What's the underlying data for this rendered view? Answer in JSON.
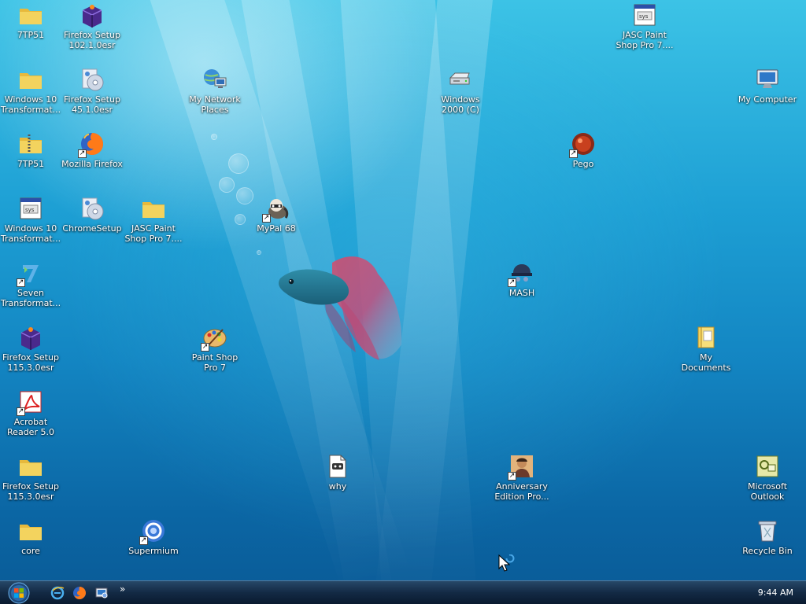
{
  "desktop": {
    "icons": [
      {
        "label": "7TP51"
      },
      {
        "label": "Firefox Setup 102.1.0esr"
      },
      {
        "label": "Windows 10 Transformat..."
      },
      {
        "label": "Firefox Setup 45.1.0esr"
      },
      {
        "label": "My Network Places"
      },
      {
        "label": "7TP51"
      },
      {
        "label": "Mozilla Firefox"
      },
      {
        "label": "Windows 10 Transformat..."
      },
      {
        "label": "ChromeSetup"
      },
      {
        "label": "JASC Paint Shop Pro 7...."
      },
      {
        "label": "MyPal 68"
      },
      {
        "label": "Seven Transformat..."
      },
      {
        "label": "Firefox Setup 115.3.0esr"
      },
      {
        "label": "Paint Shop Pro 7"
      },
      {
        "label": "Acrobat Reader 5.0"
      },
      {
        "label": "Firefox Setup 115.3.0esr"
      },
      {
        "label": "why"
      },
      {
        "label": "core"
      },
      {
        "label": "Supermium"
      },
      {
        "label": "JASC Paint Shop Pro 7...."
      },
      {
        "label": "My Computer"
      },
      {
        "label": "Windows 2000 (C)"
      },
      {
        "label": "Pego"
      },
      {
        "label": "MASH"
      },
      {
        "label": "My Documents"
      },
      {
        "label": "Anniversary Edition Pro..."
      },
      {
        "label": "Microsoft Outlook"
      },
      {
        "label": "Recycle Bin"
      }
    ]
  },
  "taskbar": {
    "quick_launch": [
      "ie-icon",
      "firefox-icon",
      "show-desktop-icon"
    ],
    "more_glyph": "»",
    "clock": "9:44 AM"
  },
  "colors": {
    "folder": "#f3d35e",
    "taskbar": "#16304d",
    "wallpaper_top": "#3cc3e6",
    "wallpaper_bottom": "#0a5a96"
  }
}
